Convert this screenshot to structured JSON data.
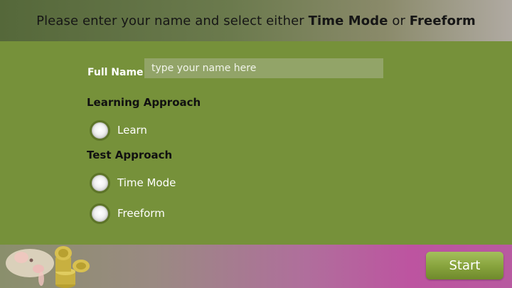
{
  "header": {
    "prefix": "Please enter your name and select either ",
    "mode_time": "Time Mode",
    "joiner": " or ",
    "mode_freeform": "Freeform"
  },
  "form": {
    "name_label": "Full Name:",
    "name_value": "",
    "name_placeholder": "type your name here",
    "learning_title": "Learning Approach",
    "learning_options": [
      "Learn"
    ],
    "test_title": "Test Approach",
    "test_options": [
      "Time Mode",
      "Freeform"
    ]
  },
  "footer": {
    "start_label": "Start",
    "mascot_icon": "piggy-bank-coins-icon"
  },
  "colors": {
    "panel": "#76913a",
    "radio_ring": "#5d7428",
    "start_button": "#86a23c",
    "footer_accent": "#bd54a0"
  }
}
